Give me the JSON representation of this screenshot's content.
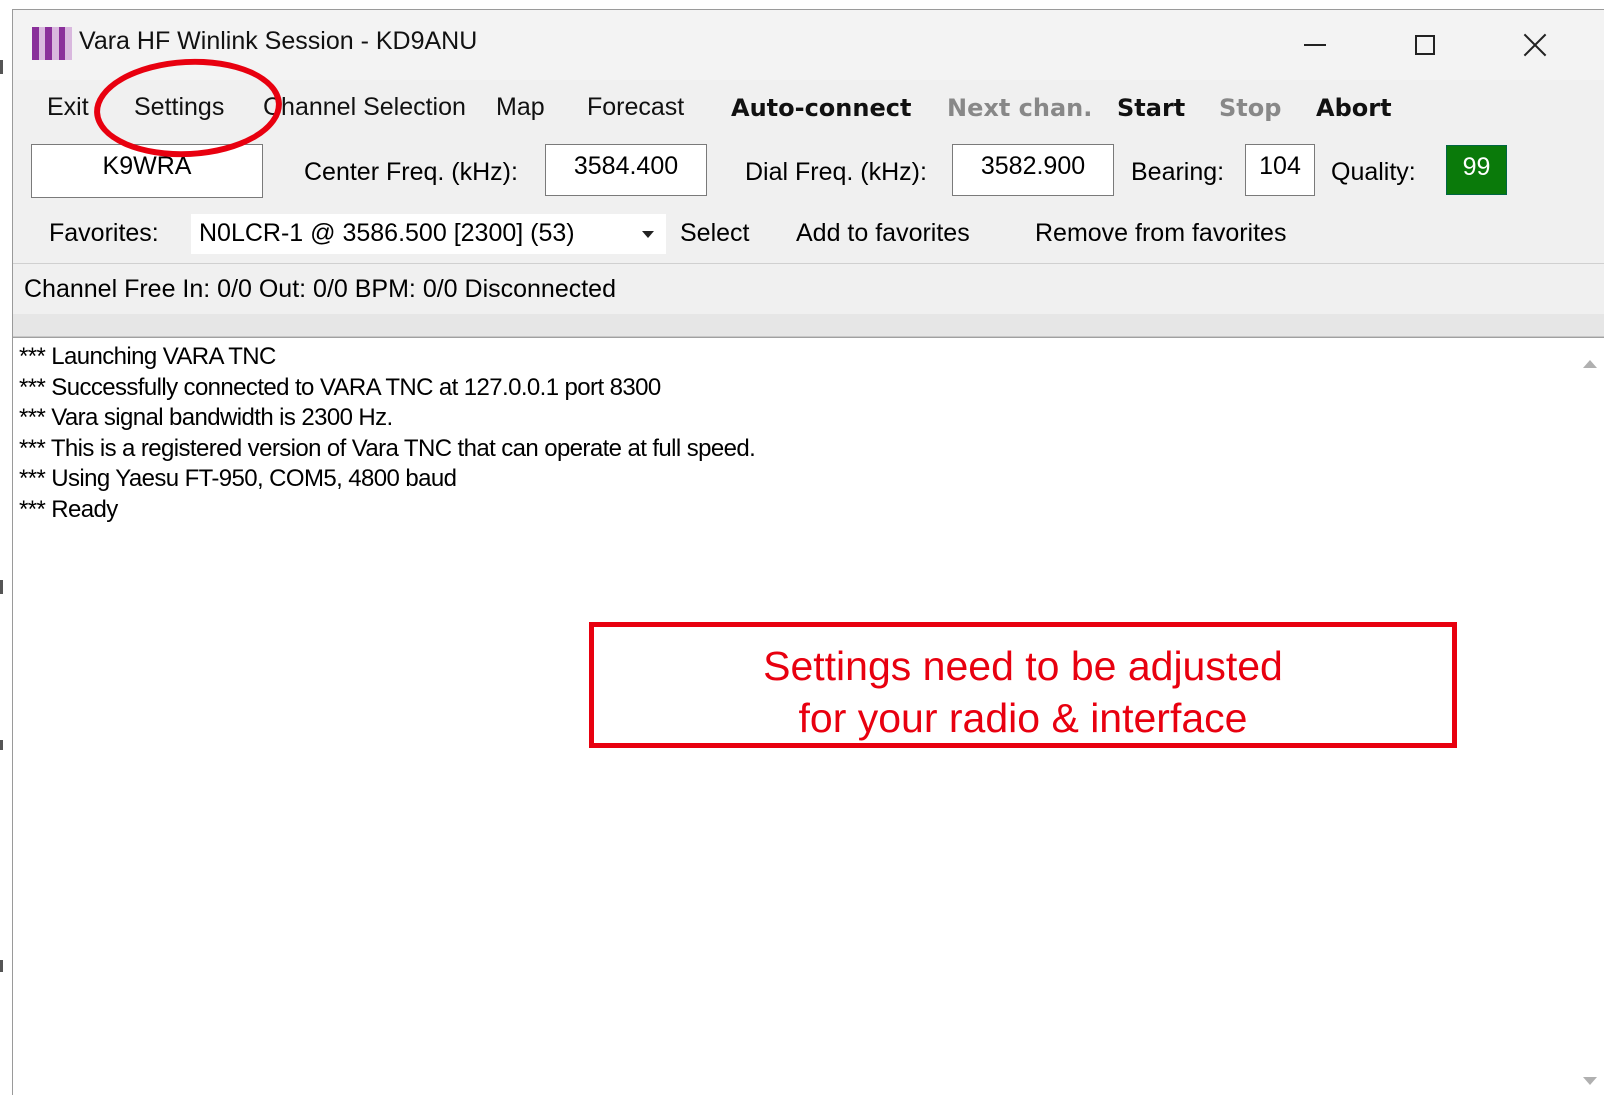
{
  "window": {
    "title": "Vara HF Winlink Session - KD9ANU",
    "icon": "checkered-app-icon",
    "controls": [
      "minimize",
      "maximize",
      "close"
    ]
  },
  "menu": {
    "exit": "Exit",
    "settings": "Settings",
    "channel_selection": "Channel Selection",
    "map": "Map",
    "forecast": "Forecast",
    "auto_connect": "Auto-connect",
    "next_chan": "Next chan.",
    "start": "Start",
    "stop": "Stop",
    "abort": "Abort"
  },
  "connection": {
    "callsign": "K9WRA",
    "center_freq_label": "Center Freq. (kHz):",
    "center_freq": "3584.400",
    "dial_freq_label": "Dial Freq. (kHz):",
    "dial_freq": "3582.900",
    "bearing_label": "Bearing:",
    "bearing": "104",
    "quality_label": "Quality:",
    "quality": "99",
    "quality_color": "#0a7a0a"
  },
  "favorites": {
    "label": "Favorites:",
    "selected": "N0LCR-1  @  3586.500 [2300]  (53)",
    "select": "Select",
    "add": "Add to favorites",
    "remove": "Remove from favorites"
  },
  "status": {
    "text": "Channel Free  In: 0/0  Out: 0/0  BPM: 0/0  Disconnected"
  },
  "log": [
    "*** Launching VARA TNC",
    "*** Successfully connected to VARA TNC at 127.0.0.1 port 8300",
    "*** Vara signal bandwidth is 2300 Hz.",
    "*** This is a registered version of Vara TNC that can operate at full speed.",
    "*** Using Yaesu FT-950, COM5, 4800 baud",
    "*** Ready"
  ],
  "annotation": {
    "line1": "Settings need to be adjusted",
    "line2": "for your radio & interface",
    "color": "#e8000f"
  }
}
